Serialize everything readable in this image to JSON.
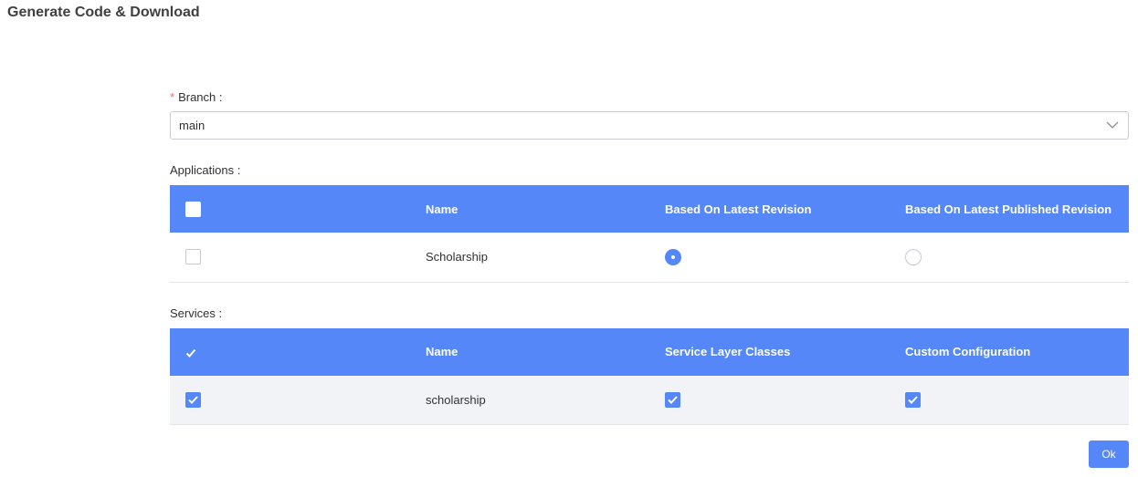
{
  "page": {
    "title": "Generate Code & Download"
  },
  "branch": {
    "required_mark": "*",
    "label": "Branch :",
    "value": "main"
  },
  "applications": {
    "label": "Applications :",
    "columns": [
      "Name",
      "Based On Latest Revision",
      "Based On Latest Published Revision"
    ],
    "rows": [
      {
        "name": "Scholarship",
        "selected": false,
        "revision": "latest"
      }
    ]
  },
  "services": {
    "label": "Services :",
    "columns": [
      "Name",
      "Service Layer Classes",
      "Custom Configuration"
    ],
    "rows": [
      {
        "name": "scholarship",
        "selected": true,
        "service_layer_classes": true,
        "custom_configuration": true
      }
    ]
  },
  "footer": {
    "ok_label": "Ok"
  },
  "colors": {
    "accent": "#5587f8",
    "required": "#f56c6c"
  }
}
